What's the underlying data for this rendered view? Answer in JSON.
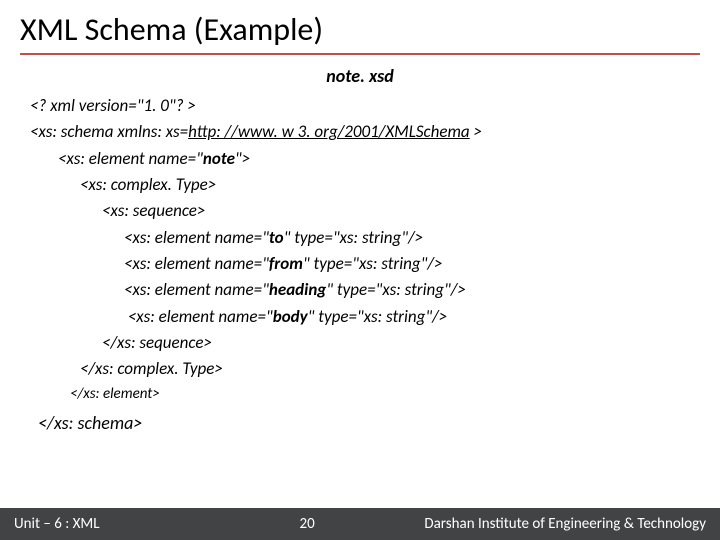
{
  "title": "XML Schema (Example)",
  "filename": "note. xsd",
  "code": {
    "l0": "<? xml version=\"1. 0\"? >",
    "l1a": "<xs: schema xmlns: xs=",
    "l1b": "http: //www. w 3. org/2001/XMLSchema",
    "l1c": " >",
    "l2a": "<xs: element name=\"",
    "l2b": "note",
    "l2c": "\">",
    "l3": "<xs: complex. Type>",
    "l4": "<xs: sequence>",
    "l5a": "<xs: element name=\"",
    "l5b": "to",
    "l5c": "\" type=\"xs: string\"/>",
    "l6a": "<xs: element name=\"",
    "l6b": "from",
    "l6c": "\" type=\"xs: string\"/>",
    "l7a": "<xs: element name=\"",
    "l7b": "heading",
    "l7c": "\" type=\"xs: string\"/>",
    "l8a": " <xs: element name=\"",
    "l8b": "body",
    "l8c": "\" type=\"xs: string\"/>",
    "l9": "</xs: sequence>",
    "l10": "</xs: complex. Type>",
    "l11": "</xs: element>",
    "l12": "</xs: schema>"
  },
  "footer": {
    "left": "Unit – 6 : XML",
    "pageNum": "20",
    "right": "Darshan Institute of Engineering & Technology"
  }
}
